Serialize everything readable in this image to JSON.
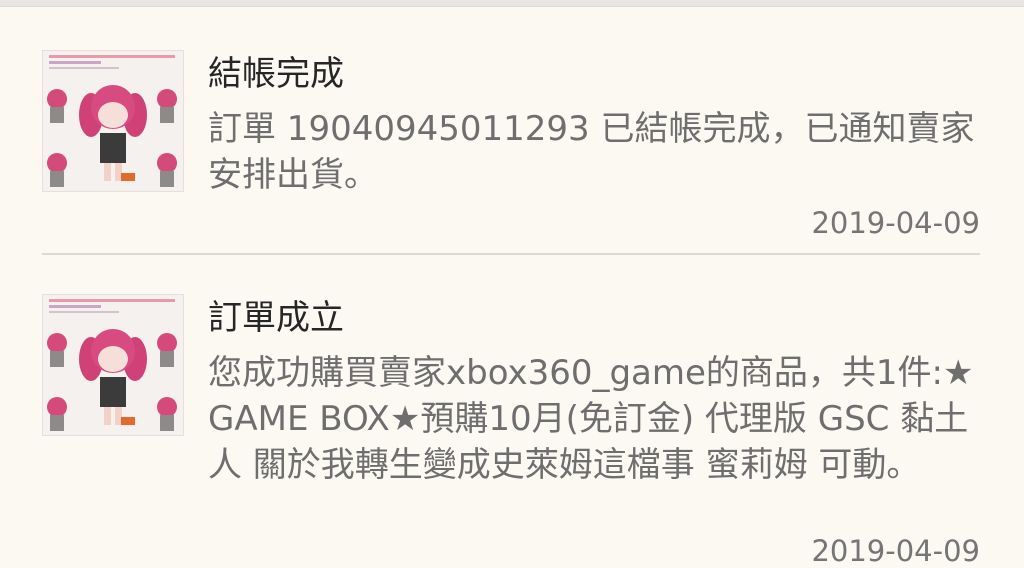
{
  "notifications": [
    {
      "title": "結帳完成",
      "body": "訂單 19040945011293 已結帳完成，已通知賣家安排出貨。",
      "date": "2019-04-09",
      "thumbnail_icon": "product-thumbnail-icon"
    },
    {
      "title": "訂單成立",
      "body": "您成功購買賣家xbox360_game的商品，共1件:★GAME BOX★預購10月(免訂金) 代理版 GSC 黏土人 關於我轉生變成史萊姆這檔事 蜜莉姆 可動。",
      "date": "2019-04-09",
      "thumbnail_icon": "product-thumbnail-icon"
    }
  ],
  "colors": {
    "background": "#fcf9f3",
    "title_text": "#262626",
    "body_text": "#6e6e6e",
    "date_text": "#757575",
    "divider": "#dcd8d2",
    "figure_hair": "#d44a7a"
  }
}
